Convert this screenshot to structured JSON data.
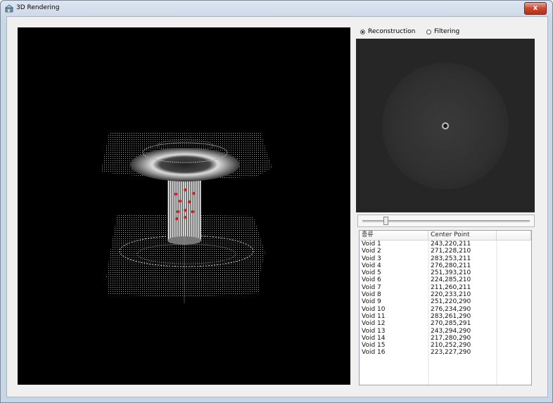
{
  "window": {
    "title": "3D Rendering",
    "close_label": "x"
  },
  "mode": {
    "options": [
      {
        "label": "Reconstruction",
        "selected": true
      },
      {
        "label": "Filtering",
        "selected": false
      }
    ]
  },
  "slider": {
    "position": 0.13
  },
  "void_table": {
    "columns": [
      "종류",
      "Center Point"
    ],
    "rows": [
      {
        "name": "Void 1",
        "center": "243,220,211"
      },
      {
        "name": "Void 2",
        "center": "271,228,210"
      },
      {
        "name": "Void 3",
        "center": "283,253,211"
      },
      {
        "name": "Void 4",
        "center": "276,280,211"
      },
      {
        "name": "Void 5",
        "center": "251,393,210"
      },
      {
        "name": "Void 6",
        "center": "224,285,210"
      },
      {
        "name": "Void 7",
        "center": "211,260,211"
      },
      {
        "name": "Void 8",
        "center": "220,233,210"
      },
      {
        "name": "Void 9",
        "center": "251,220,290"
      },
      {
        "name": "Void 10",
        "center": "276,234,290"
      },
      {
        "name": "Void 11",
        "center": "283,261,290"
      },
      {
        "name": "Void 12",
        "center": "270,285,291"
      },
      {
        "name": "Void 13",
        "center": "243,294,290"
      },
      {
        "name": "Void 14",
        "center": "217,280,290"
      },
      {
        "name": "Void 15",
        "center": "210,252,290"
      },
      {
        "name": "Void 16",
        "center": "223,227,290"
      }
    ]
  },
  "colors": {
    "render_bg": "#000000",
    "void_marker": "#d21e1e",
    "preview_bg": "#262626"
  }
}
